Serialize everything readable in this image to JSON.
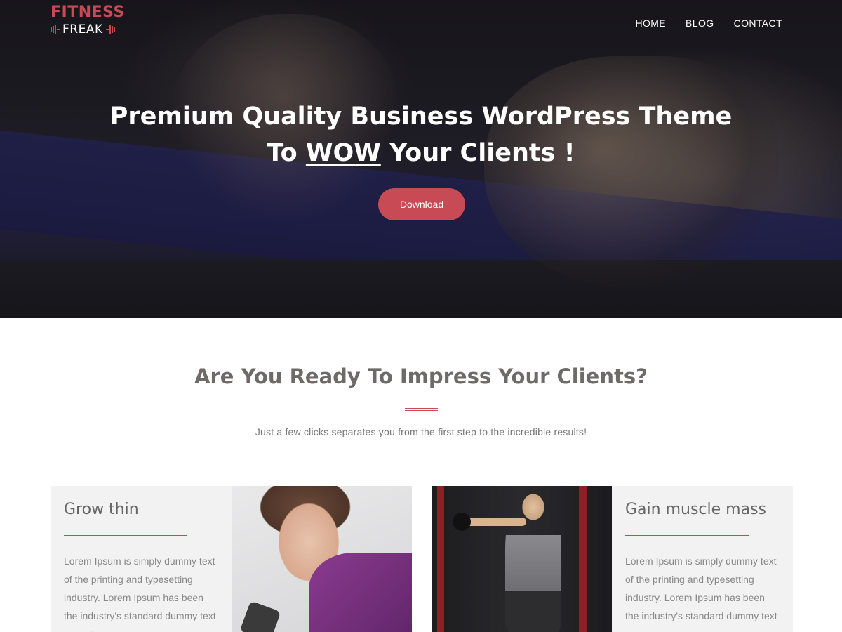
{
  "logo": {
    "top": "FITNESS",
    "bottom": "FREAK"
  },
  "nav": {
    "items": [
      {
        "label": "HOME"
      },
      {
        "label": "BLOG"
      },
      {
        "label": "CONTACT"
      }
    ]
  },
  "hero": {
    "title_line1": "Premium Quality Business WordPress Theme",
    "title_line2_prefix": "To ",
    "title_line2_emphasis": "WOW",
    "title_line2_suffix": " Your Clients !",
    "cta_label": "Download"
  },
  "section": {
    "title": "Are You Ready To Impress Your Clients?",
    "subtitle": "Just a few clicks separates you from the first step to the incredible results!"
  },
  "cards": [
    {
      "title": "Grow thin",
      "body": "Lorem Ipsum is simply dummy text of the printing and typesetting industry. Lorem Ipsum has been the industry's standard dummy text ever since"
    },
    {
      "title": "Gain muscle mass",
      "body": "Lorem Ipsum is simply dummy text of the printing and typesetting industry. Lorem Ipsum has been the industry's standard dummy text ever since"
    }
  ],
  "colors": {
    "accent": "#c84a55",
    "heading": "#6e6a6a",
    "card_bg": "#f2f2f2"
  }
}
